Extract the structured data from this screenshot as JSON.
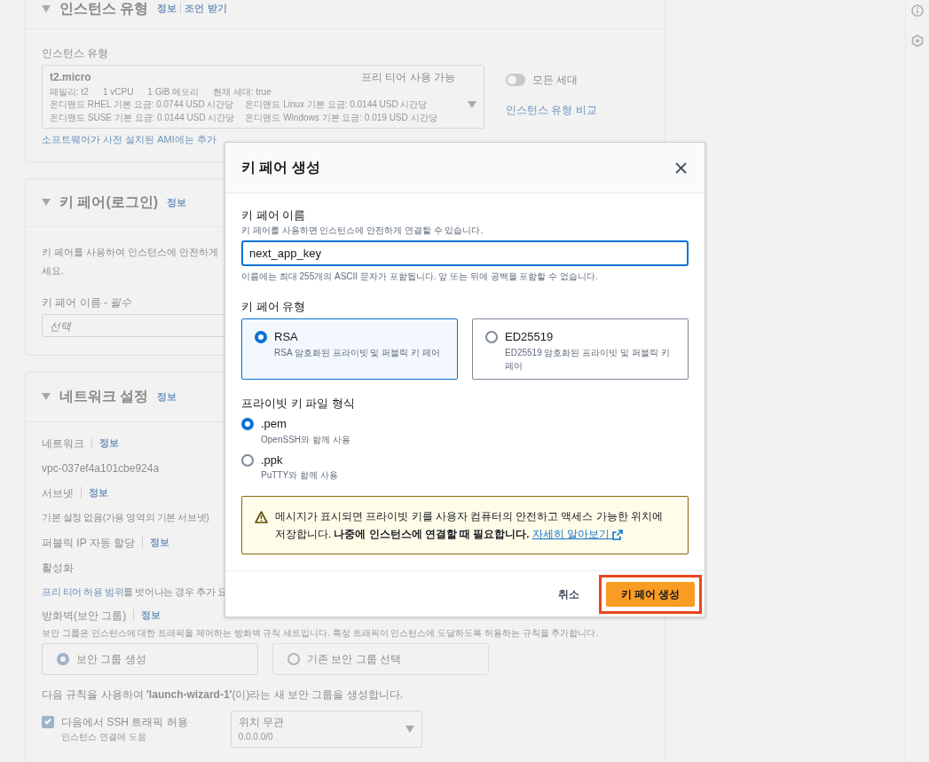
{
  "instance_type_section": {
    "title": "인스턴스 유형",
    "links": [
      "정보",
      "조언 받기"
    ],
    "field_label": "인스턴스 유형",
    "select": {
      "value": "t2.micro",
      "badge": "프리 티어 사용 가능",
      "specs": [
        "패밀리: t2",
        "1 vCPU",
        "1 GiB 메모리",
        "현재 세대: true"
      ],
      "prices": [
        "온디맨드 RHEL 기본 요금: 0.0744 USD 시간당",
        "온디맨드 Linux 기본 요금: 0.0144 USD 시간당",
        "온디맨드 SUSE 기본 요금: 0.0144 USD 시간당",
        "온디맨드 Windows 기본 요금: 0.019 USD 시간당"
      ]
    },
    "toggle": {
      "label": "모든 세대",
      "on": false
    },
    "compare_link": "인스턴스 유형 비교",
    "note_link": "소프트웨어가 사전 설치된 AMI에는 추가"
  },
  "key_pair_section": {
    "title": "키 페어(로그인)",
    "info": "정보",
    "description_lines": [
      "키 페어를 사용하여 인스턴스에 안전하게",
      "세요."
    ],
    "field_label": "키 페어 이름 - *필수*",
    "select_placeholder": "선택"
  },
  "network_section": {
    "title": "네트워크 설정",
    "info": "정보",
    "fields": [
      {
        "label": "네트워크",
        "info": "정보",
        "value": "vpc-037ef4a101cbe924a"
      },
      {
        "label": "서브넷",
        "info": "정보",
        "value": "기본 설정 없음(가용 영역의 기본 서브넷)"
      },
      {
        "label": "퍼블릭 IP 자동 할당",
        "info": "정보",
        "value": "활성화"
      }
    ],
    "free_tier_note": {
      "link": "프리 티어 허용 범위",
      "text": "를 벗어나는 경우 추가 요"
    },
    "firewall": {
      "label": "방화벽(보안 그룹)",
      "info": "정보",
      "description": "보안 그룹은 인스턴스에 대한 트래픽을 제어하는 방화벽 규칙 세트입니다. 특정 트래픽이 인스턴스에 도달하도록 허용하는 규칙을 추가합니다.",
      "options": [
        {
          "label": "보안 그룹 생성",
          "selected": true
        },
        {
          "label": "기존 보안 그룹 선택",
          "selected": false
        }
      ],
      "rule_text": "다음 규칙을 사용하여 **'launch-wizard-1'**(이)라는 새 보안 그룹을 생성합니다.",
      "ssh": {
        "label": "다음에서 SSH 트래픽 허용",
        "hint": "인스턴스 연결에 도움",
        "checked": true,
        "source": "위치 무관",
        "source_detail": "0.0.0.0/0"
      }
    }
  },
  "modal": {
    "title": "키 페어 생성",
    "name_field": {
      "label": "키 페어 이름",
      "description": "키 페어를 사용하면 인스턴스에 안전하게 연결할 수 있습니다.",
      "value": "next_app_key",
      "constraint": "이름에는 최대 255개의 ASCII 문자가 포함됩니다. 앞 또는 뒤에 공백을 포함할 수 없습니다."
    },
    "type_label": "키 페어 유형",
    "types": [
      {
        "label": "RSA",
        "description": "RSA 암호화된 프라이빗 및 퍼블릭 키 페어",
        "selected": true
      },
      {
        "label": "ED25519",
        "description": "ED25519 암호화된 프라이빗 및 퍼블릭 키 페어",
        "selected": false
      }
    ],
    "format_label": "프라이빗 키 파일 형식",
    "formats": [
      {
        "label": ".pem",
        "description": "OpenSSH와 함께 사용",
        "selected": true
      },
      {
        "label": ".ppk",
        "description": "PuTTY와 함께 사용",
        "selected": false
      }
    ],
    "alert": {
      "text": "메시지가 표시되면 프라이빗 키를 사용자 컴퓨터의 안전하고 액세스 가능한 위치에 저장합니다. **나중에 인스턴스에 연결할 때 필요합니다.** ",
      "link": "자세히 알아보기"
    },
    "cancel": "취소",
    "submit": "키 페어 생성",
    "submit_highlighted": true
  }
}
